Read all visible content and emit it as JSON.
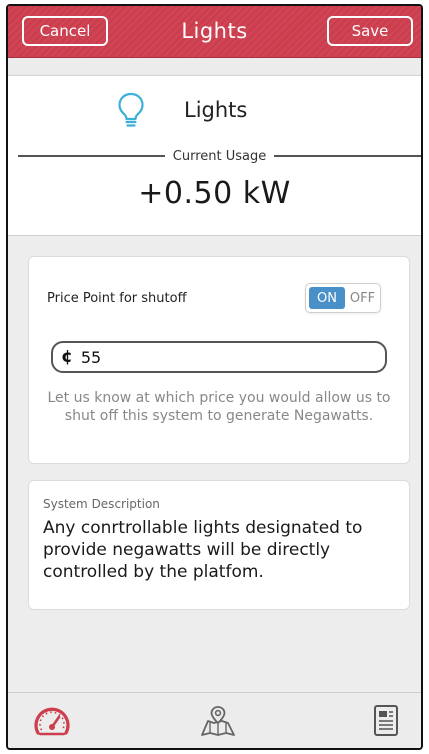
{
  "header": {
    "title": "Lights",
    "cancel_label": "Cancel",
    "save_label": "Save"
  },
  "device": {
    "name": "Lights",
    "icon": "lightbulb-icon",
    "icon_color": "#3db0d8"
  },
  "usage": {
    "label": "Current Usage",
    "value": "+0.50 kW"
  },
  "price_point": {
    "label": "Price Point for shutoff",
    "toggle_on": "ON",
    "toggle_off": "OFF",
    "toggle_state": "ON",
    "currency_symbol": "¢",
    "value": "55",
    "help_text": "Let us know at which price you would allow us to shut off this system to generate Negawatts."
  },
  "description": {
    "label": "System Description",
    "text": "Any conrtrollable lights designated to provide negawatts will be directly controlled by the platfom."
  },
  "tabbar": {
    "items": [
      {
        "icon": "gauge-icon",
        "active": true
      },
      {
        "icon": "map-icon",
        "active": false
      },
      {
        "icon": "document-icon",
        "active": false
      }
    ]
  },
  "colors": {
    "header": "#cc3d4d",
    "accent_active": "#cc3d4d",
    "toggle_on": "#4a90c8"
  }
}
